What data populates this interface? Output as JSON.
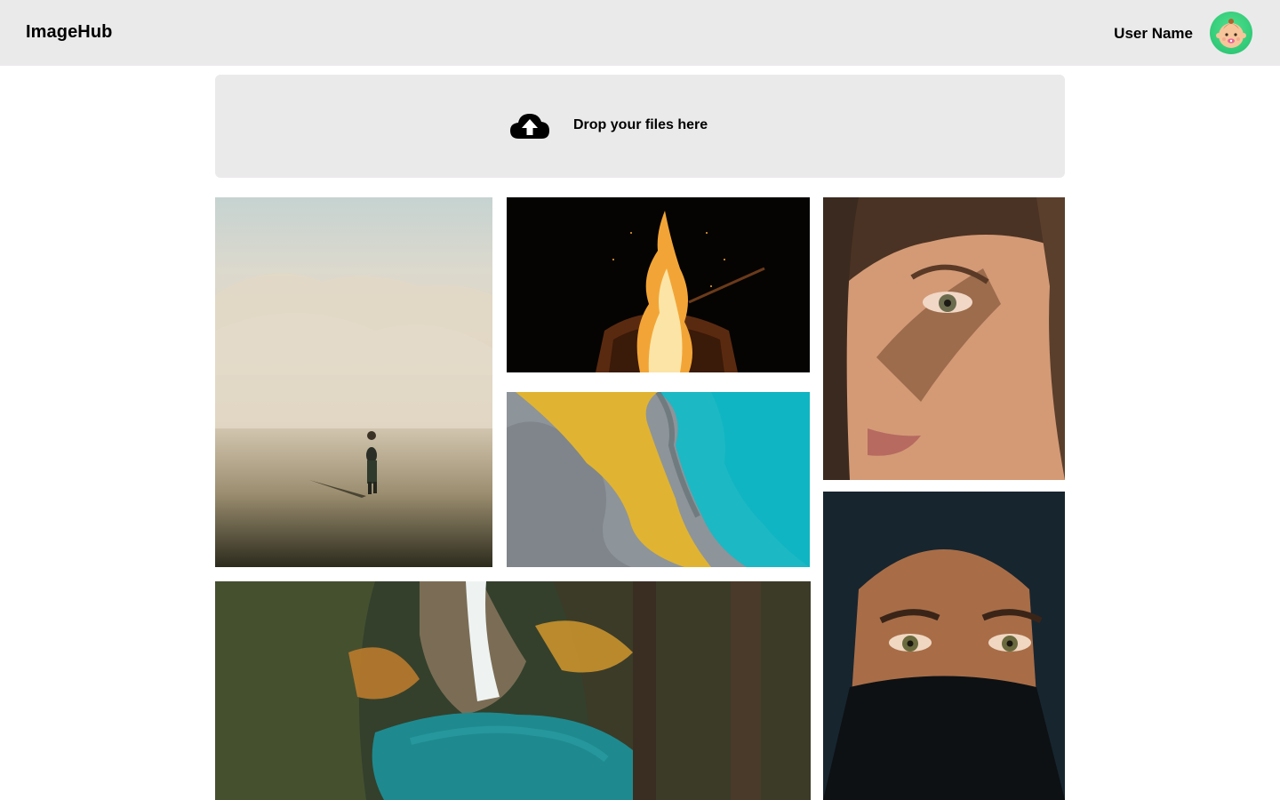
{
  "header": {
    "logo": "ImageHub",
    "user_name": "User Name",
    "avatar_icon": "baby-face-avatar-icon"
  },
  "upload": {
    "label": "Drop your files here",
    "icon": "cloud-upload-icon"
  },
  "gallery": {
    "images": [
      {
        "subject": "desert-walker-photo"
      },
      {
        "subject": "campfire-photo"
      },
      {
        "subject": "aerial-river-delta-photo"
      },
      {
        "subject": "woman-face-shadow-photo"
      },
      {
        "subject": "waterfall-forest-photo"
      },
      {
        "subject": "veiled-woman-photo"
      }
    ]
  },
  "colors": {
    "header_bg": "#ebeaeb",
    "dropzone_bg": "#ebeaeb",
    "avatar_bg": "#2fcf79"
  }
}
